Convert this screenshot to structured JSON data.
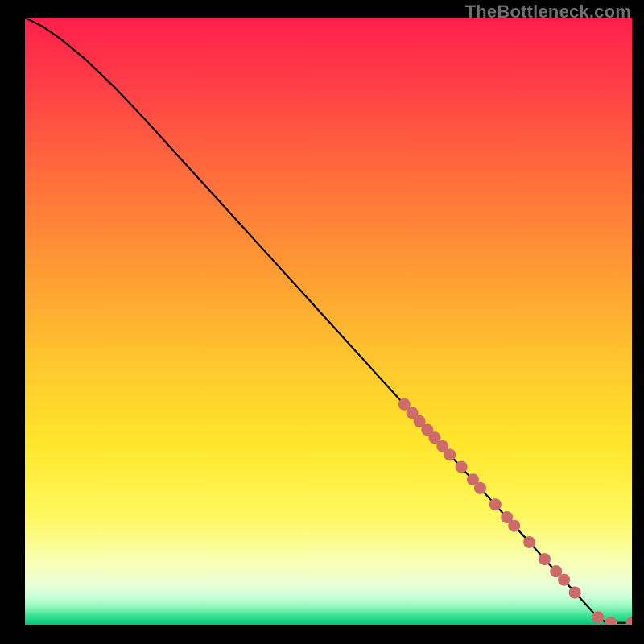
{
  "watermark": "TheBottleneck.com",
  "colors": {
    "black": "#000000",
    "curve": "#000000",
    "dot": "#cd6a6a",
    "gradient_stops": [
      {
        "offset": 0.0,
        "color": "#ff1f4a"
      },
      {
        "offset": 0.1,
        "color": "#ff3b47"
      },
      {
        "offset": 0.25,
        "color": "#ff6a3d"
      },
      {
        "offset": 0.4,
        "color": "#ff9635"
      },
      {
        "offset": 0.55,
        "color": "#ffc22e"
      },
      {
        "offset": 0.7,
        "color": "#ffe62a"
      },
      {
        "offset": 0.82,
        "color": "#fff85e"
      },
      {
        "offset": 0.9,
        "color": "#f8ffb8"
      },
      {
        "offset": 0.935,
        "color": "#e8ffd6"
      },
      {
        "offset": 0.955,
        "color": "#c8ffd8"
      },
      {
        "offset": 0.972,
        "color": "#8cf5b8"
      },
      {
        "offset": 0.986,
        "color": "#34e191"
      },
      {
        "offset": 1.0,
        "color": "#00c775"
      }
    ]
  },
  "chart_data": {
    "type": "line",
    "title": "",
    "xlabel": "",
    "ylabel": "",
    "xlim": [
      0,
      100
    ],
    "ylim": [
      0,
      100
    ],
    "grid": false,
    "legend": false,
    "series": [
      {
        "name": "curve",
        "x": [
          0,
          3,
          6,
          10,
          15,
          20,
          30,
          40,
          50,
          60,
          67,
          74,
          78,
          82,
          86,
          89,
          91,
          94,
          95.5,
          97,
          100
        ],
        "y": [
          100,
          98.5,
          96.4,
          93.1,
          88.3,
          83.0,
          72.0,
          61.0,
          50.0,
          39.0,
          31.3,
          23.6,
          19.2,
          14.8,
          10.4,
          7.1,
          4.9,
          1.6,
          0.5,
          0.3,
          0.3
        ]
      }
    ],
    "points": {
      "name": "dots",
      "x": [
        62.5,
        63.8,
        65.0,
        66.3,
        67.5,
        68.8,
        70.0,
        71.9,
        73.8,
        75.0,
        77.5,
        79.4,
        80.6,
        83.1,
        85.6,
        87.5,
        88.8,
        90.6,
        94.4,
        96.5,
        100.0
      ],
      "y": [
        36.3,
        34.9,
        33.5,
        32.1,
        30.8,
        29.4,
        28.0,
        26.0,
        23.9,
        22.5,
        19.8,
        17.7,
        16.3,
        13.6,
        10.8,
        8.8,
        7.4,
        5.3,
        1.2,
        0.3,
        0.3
      ]
    }
  }
}
